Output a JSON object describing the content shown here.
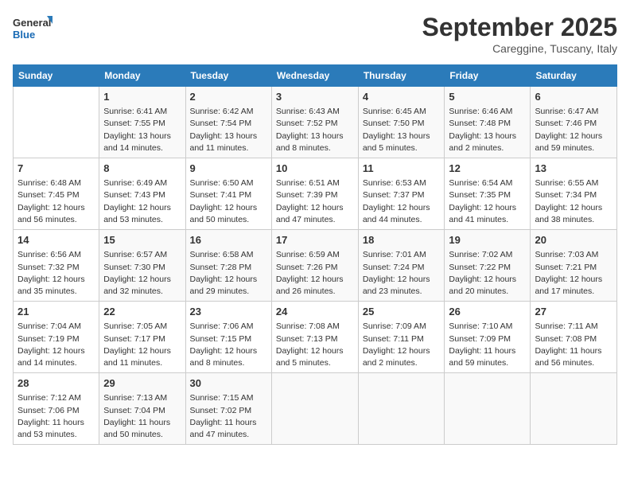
{
  "header": {
    "logo_line1": "General",
    "logo_line2": "Blue",
    "month": "September 2025",
    "location": "Careggine, Tuscany, Italy"
  },
  "days_of_week": [
    "Sunday",
    "Monday",
    "Tuesday",
    "Wednesday",
    "Thursday",
    "Friday",
    "Saturday"
  ],
  "weeks": [
    [
      {
        "day": "",
        "info": ""
      },
      {
        "day": "1",
        "info": "Sunrise: 6:41 AM\nSunset: 7:55 PM\nDaylight: 13 hours\nand 14 minutes."
      },
      {
        "day": "2",
        "info": "Sunrise: 6:42 AM\nSunset: 7:54 PM\nDaylight: 13 hours\nand 11 minutes."
      },
      {
        "day": "3",
        "info": "Sunrise: 6:43 AM\nSunset: 7:52 PM\nDaylight: 13 hours\nand 8 minutes."
      },
      {
        "day": "4",
        "info": "Sunrise: 6:45 AM\nSunset: 7:50 PM\nDaylight: 13 hours\nand 5 minutes."
      },
      {
        "day": "5",
        "info": "Sunrise: 6:46 AM\nSunset: 7:48 PM\nDaylight: 13 hours\nand 2 minutes."
      },
      {
        "day": "6",
        "info": "Sunrise: 6:47 AM\nSunset: 7:46 PM\nDaylight: 12 hours\nand 59 minutes."
      }
    ],
    [
      {
        "day": "7",
        "info": "Sunrise: 6:48 AM\nSunset: 7:45 PM\nDaylight: 12 hours\nand 56 minutes."
      },
      {
        "day": "8",
        "info": "Sunrise: 6:49 AM\nSunset: 7:43 PM\nDaylight: 12 hours\nand 53 minutes."
      },
      {
        "day": "9",
        "info": "Sunrise: 6:50 AM\nSunset: 7:41 PM\nDaylight: 12 hours\nand 50 minutes."
      },
      {
        "day": "10",
        "info": "Sunrise: 6:51 AM\nSunset: 7:39 PM\nDaylight: 12 hours\nand 47 minutes."
      },
      {
        "day": "11",
        "info": "Sunrise: 6:53 AM\nSunset: 7:37 PM\nDaylight: 12 hours\nand 44 minutes."
      },
      {
        "day": "12",
        "info": "Sunrise: 6:54 AM\nSunset: 7:35 PM\nDaylight: 12 hours\nand 41 minutes."
      },
      {
        "day": "13",
        "info": "Sunrise: 6:55 AM\nSunset: 7:34 PM\nDaylight: 12 hours\nand 38 minutes."
      }
    ],
    [
      {
        "day": "14",
        "info": "Sunrise: 6:56 AM\nSunset: 7:32 PM\nDaylight: 12 hours\nand 35 minutes."
      },
      {
        "day": "15",
        "info": "Sunrise: 6:57 AM\nSunset: 7:30 PM\nDaylight: 12 hours\nand 32 minutes."
      },
      {
        "day": "16",
        "info": "Sunrise: 6:58 AM\nSunset: 7:28 PM\nDaylight: 12 hours\nand 29 minutes."
      },
      {
        "day": "17",
        "info": "Sunrise: 6:59 AM\nSunset: 7:26 PM\nDaylight: 12 hours\nand 26 minutes."
      },
      {
        "day": "18",
        "info": "Sunrise: 7:01 AM\nSunset: 7:24 PM\nDaylight: 12 hours\nand 23 minutes."
      },
      {
        "day": "19",
        "info": "Sunrise: 7:02 AM\nSunset: 7:22 PM\nDaylight: 12 hours\nand 20 minutes."
      },
      {
        "day": "20",
        "info": "Sunrise: 7:03 AM\nSunset: 7:21 PM\nDaylight: 12 hours\nand 17 minutes."
      }
    ],
    [
      {
        "day": "21",
        "info": "Sunrise: 7:04 AM\nSunset: 7:19 PM\nDaylight: 12 hours\nand 14 minutes."
      },
      {
        "day": "22",
        "info": "Sunrise: 7:05 AM\nSunset: 7:17 PM\nDaylight: 12 hours\nand 11 minutes."
      },
      {
        "day": "23",
        "info": "Sunrise: 7:06 AM\nSunset: 7:15 PM\nDaylight: 12 hours\nand 8 minutes."
      },
      {
        "day": "24",
        "info": "Sunrise: 7:08 AM\nSunset: 7:13 PM\nDaylight: 12 hours\nand 5 minutes."
      },
      {
        "day": "25",
        "info": "Sunrise: 7:09 AM\nSunset: 7:11 PM\nDaylight: 12 hours\nand 2 minutes."
      },
      {
        "day": "26",
        "info": "Sunrise: 7:10 AM\nSunset: 7:09 PM\nDaylight: 11 hours\nand 59 minutes."
      },
      {
        "day": "27",
        "info": "Sunrise: 7:11 AM\nSunset: 7:08 PM\nDaylight: 11 hours\nand 56 minutes."
      }
    ],
    [
      {
        "day": "28",
        "info": "Sunrise: 7:12 AM\nSunset: 7:06 PM\nDaylight: 11 hours\nand 53 minutes."
      },
      {
        "day": "29",
        "info": "Sunrise: 7:13 AM\nSunset: 7:04 PM\nDaylight: 11 hours\nand 50 minutes."
      },
      {
        "day": "30",
        "info": "Sunrise: 7:15 AM\nSunset: 7:02 PM\nDaylight: 11 hours\nand 47 minutes."
      },
      {
        "day": "",
        "info": ""
      },
      {
        "day": "",
        "info": ""
      },
      {
        "day": "",
        "info": ""
      },
      {
        "day": "",
        "info": ""
      }
    ]
  ]
}
